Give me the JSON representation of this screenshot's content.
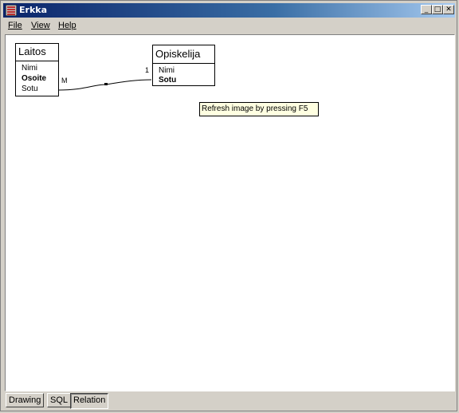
{
  "window": {
    "title": "Erkka",
    "minimize_label": "_",
    "maximize_label": "□",
    "close_label": "✕"
  },
  "menu": {
    "items": [
      "File",
      "View",
      "Help"
    ]
  },
  "diagram": {
    "entities": [
      {
        "name": "Laitos",
        "attributes": [
          {
            "label": "Nimi",
            "key": false
          },
          {
            "label": "Osoite",
            "key": true
          },
          {
            "label": "Sotu",
            "key": false
          }
        ]
      },
      {
        "name": "Opiskelija",
        "attributes": [
          {
            "label": "Nimi",
            "key": false
          },
          {
            "label": "Sotu",
            "key": true
          }
        ]
      }
    ],
    "relation": {
      "from_cardinality": "M",
      "to_cardinality": "1"
    }
  },
  "tooltip": {
    "text": "Refresh image by pressing F5"
  },
  "tabs": [
    {
      "label": "Drawing",
      "active": false
    },
    {
      "label": "SQL",
      "active": false
    },
    {
      "label": "Relation",
      "active": true
    }
  ]
}
